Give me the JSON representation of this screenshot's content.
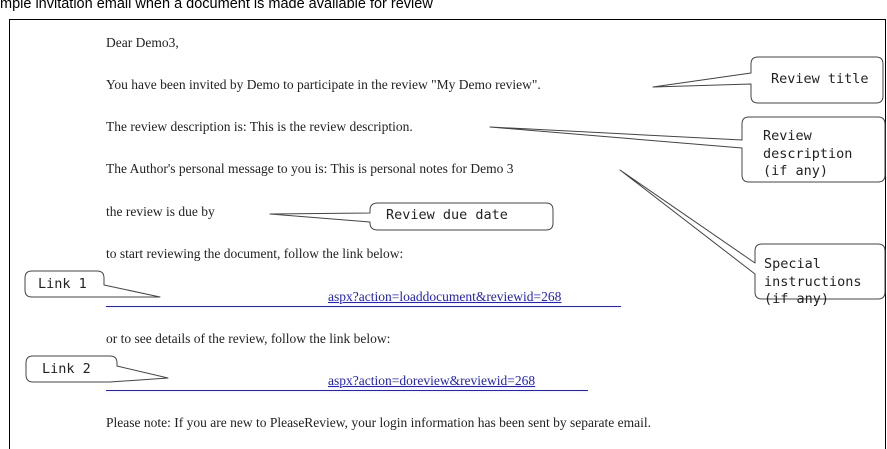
{
  "caption": "mple invitation email when a document is made available for review",
  "email": {
    "greeting": "Dear Demo3,",
    "invited": "You have been invited by Demo to participate in the review \"My Demo review\".",
    "description": "The review description is: This is the review description.",
    "personal_message": "The Author's personal message to you is: This is personal notes for Demo 3",
    "due": "the review is due by",
    "start_instruction": "to start reviewing the document, follow the link below:",
    "link1": "aspx?action=loaddocument&reviewid=268",
    "details_instruction": "or to see details of the review, follow the link below:",
    "link2": "aspx?action=doreview&reviewid=268",
    "note": "Please note: If you are new to PleaseReview, your login information has been sent by separate email."
  },
  "callouts": {
    "review_title": "Review title",
    "review_description": [
      "Review",
      "description",
      "(if any)"
    ],
    "special_instructions": [
      "Special",
      "instructions",
      "(if any)"
    ],
    "review_due_date": "Review due date",
    "link_1": "Link 1",
    "link_2": "Link 2"
  }
}
